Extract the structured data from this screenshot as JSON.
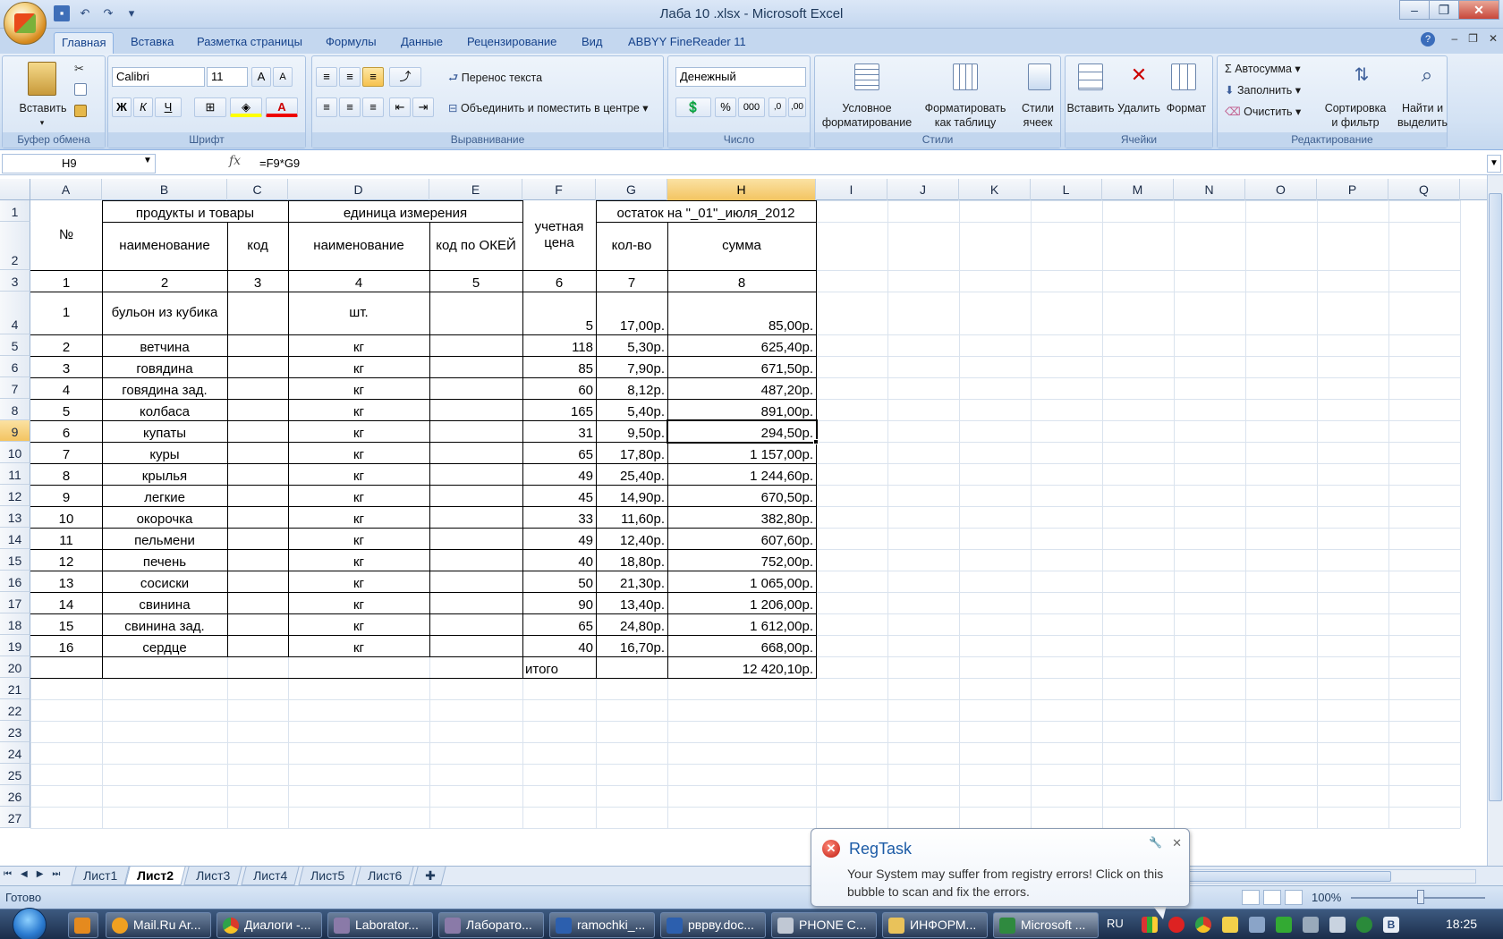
{
  "window": {
    "title": "Лаба 10 .xlsx - Microsoft Excel"
  },
  "ribbon_tabs": [
    "Главная",
    "Вставка",
    "Разметка страницы",
    "Формулы",
    "Данные",
    "Рецензирование",
    "Вид",
    "ABBYY FineReader 11"
  ],
  "clipboard": {
    "paste": "Вставить",
    "label": "Буфер обмена"
  },
  "font": {
    "name": "Calibri",
    "size": "11",
    "bold": "Ж",
    "italic": "К",
    "underline": "Ч",
    "label": "Шрифт"
  },
  "alignment": {
    "wrap": "Перенос текста",
    "merge": "Объединить и поместить в центре",
    "label": "Выравнивание"
  },
  "number": {
    "format": "Денежный",
    "label": "Число",
    "percent": "%",
    "thousands": "000"
  },
  "styles": {
    "conditional": "Условное",
    "conditional2": "форматирование",
    "format_table": "Форматировать",
    "format_table2": "как таблицу",
    "cell_styles": "Стили",
    "cell_styles2": "ячеек",
    "label": "Стили"
  },
  "cells_group": {
    "insert": "Вставить",
    "delete": "Удалить",
    "format": "Формат",
    "label": "Ячейки"
  },
  "editing": {
    "autosum": "Автосумма",
    "fill": "Заполнить",
    "clear": "Очистить",
    "sort": "Сортировка",
    "sort2": "и фильтр",
    "find": "Найти и",
    "find2": "выделить",
    "label": "Редактирование"
  },
  "formula_bar": {
    "name_box": "H9",
    "fx": "fx",
    "formula": "=F9*G9"
  },
  "columns": [
    "A",
    "B",
    "C",
    "D",
    "E",
    "F",
    "G",
    "H",
    "I",
    "J",
    "K",
    "L",
    "M",
    "N",
    "O",
    "P",
    "Q"
  ],
  "rows": [
    "1",
    "2",
    "3",
    "4",
    "5",
    "6",
    "7",
    "8",
    "9",
    "10",
    "11",
    "12",
    "13",
    "14",
    "15",
    "16",
    "17",
    "18",
    "19",
    "20",
    "21",
    "22",
    "23",
    "24",
    "25",
    "26",
    "27"
  ],
  "table": {
    "h_no": "№",
    "h_products": "продукты и товары",
    "h_unit": "единица измерения",
    "h_name": "наименование",
    "h_code": "код",
    "h_unit_name": "наименование",
    "h_okei": "код по ОКЕЙ",
    "h_price": "учетная цена",
    "h_balance": "остаток на \"_01\"_июля_2012",
    "h_qty": "кол-во",
    "h_sum": "сумма",
    "nums": [
      "1",
      "2",
      "3",
      "4",
      "5",
      "6",
      "7",
      "8"
    ],
    "items": [
      {
        "n": "1",
        "name": "бульон из кубика",
        "unit": "шт.",
        "price": "5",
        "qty": "17,00р.",
        "sum": "85,00р."
      },
      {
        "n": "2",
        "name": "ветчина",
        "unit": "кг",
        "price": "118",
        "qty": "5,30р.",
        "sum": "625,40р."
      },
      {
        "n": "3",
        "name": "говядина",
        "unit": "кг",
        "price": "85",
        "qty": "7,90р.",
        "sum": "671,50р."
      },
      {
        "n": "4",
        "name": "говядина зад.",
        "unit": "кг",
        "price": "60",
        "qty": "8,12р.",
        "sum": "487,20р."
      },
      {
        "n": "5",
        "name": "колбаса",
        "unit": "кг",
        "price": "165",
        "qty": "5,40р.",
        "sum": "891,00р."
      },
      {
        "n": "6",
        "name": "купаты",
        "unit": "кг",
        "price": "31",
        "qty": "9,50р.",
        "sum": "294,50р."
      },
      {
        "n": "7",
        "name": "куры",
        "unit": "кг",
        "price": "65",
        "qty": "17,80р.",
        "sum": "1 157,00р."
      },
      {
        "n": "8",
        "name": "крылья",
        "unit": "кг",
        "price": "49",
        "qty": "25,40р.",
        "sum": "1 244,60р."
      },
      {
        "n": "9",
        "name": "легкие",
        "unit": "кг",
        "price": "45",
        "qty": "14,90р.",
        "sum": "670,50р."
      },
      {
        "n": "10",
        "name": "окорочка",
        "unit": "кг",
        "price": "33",
        "qty": "11,60р.",
        "sum": "382,80р."
      },
      {
        "n": "11",
        "name": "пельмени",
        "unit": "кг",
        "price": "49",
        "qty": "12,40р.",
        "sum": "607,60р."
      },
      {
        "n": "12",
        "name": "печень",
        "unit": "кг",
        "price": "40",
        "qty": "18,80р.",
        "sum": "752,00р."
      },
      {
        "n": "13",
        "name": "сосиски",
        "unit": "кг",
        "price": "50",
        "qty": "21,30р.",
        "sum": "1 065,00р."
      },
      {
        "n": "14",
        "name": "свинина",
        "unit": "кг",
        "price": "90",
        "qty": "13,40р.",
        "sum": "1 206,00р."
      },
      {
        "n": "15",
        "name": "свинина зад.",
        "unit": "кг",
        "price": "65",
        "qty": "24,80р.",
        "sum": "1 612,00р."
      },
      {
        "n": "16",
        "name": "сердце",
        "unit": "кг",
        "price": "40",
        "qty": "16,70р.",
        "sum": "668,00р."
      }
    ],
    "total_label": "итого",
    "total_sum": "12 420,10р."
  },
  "sheets": [
    "Лист1",
    "Лист2",
    "Лист3",
    "Лист4",
    "Лист5",
    "Лист6"
  ],
  "active_sheet": "Лист2",
  "status": {
    "text": "Готово",
    "zoom": "100%"
  },
  "balloon": {
    "title": "RegTask",
    "body": "Your System may suffer from registry errors! Click on this bubble to scan and fix the errors."
  },
  "taskbar": {
    "items": [
      "Mail.Ru Ar...",
      "Диалоги -...",
      "Laborator...",
      "Лаборато...",
      "ramochki_...",
      "рврву.doc...",
      "PHONE C...",
      "ИНФОРМ...",
      "Microsoft ..."
    ],
    "lang": "RU",
    "clock": "18:25"
  },
  "colors": {
    "accent": "#15428b",
    "selection": "#f3c461",
    "ribbon": "#d3e2f4"
  }
}
